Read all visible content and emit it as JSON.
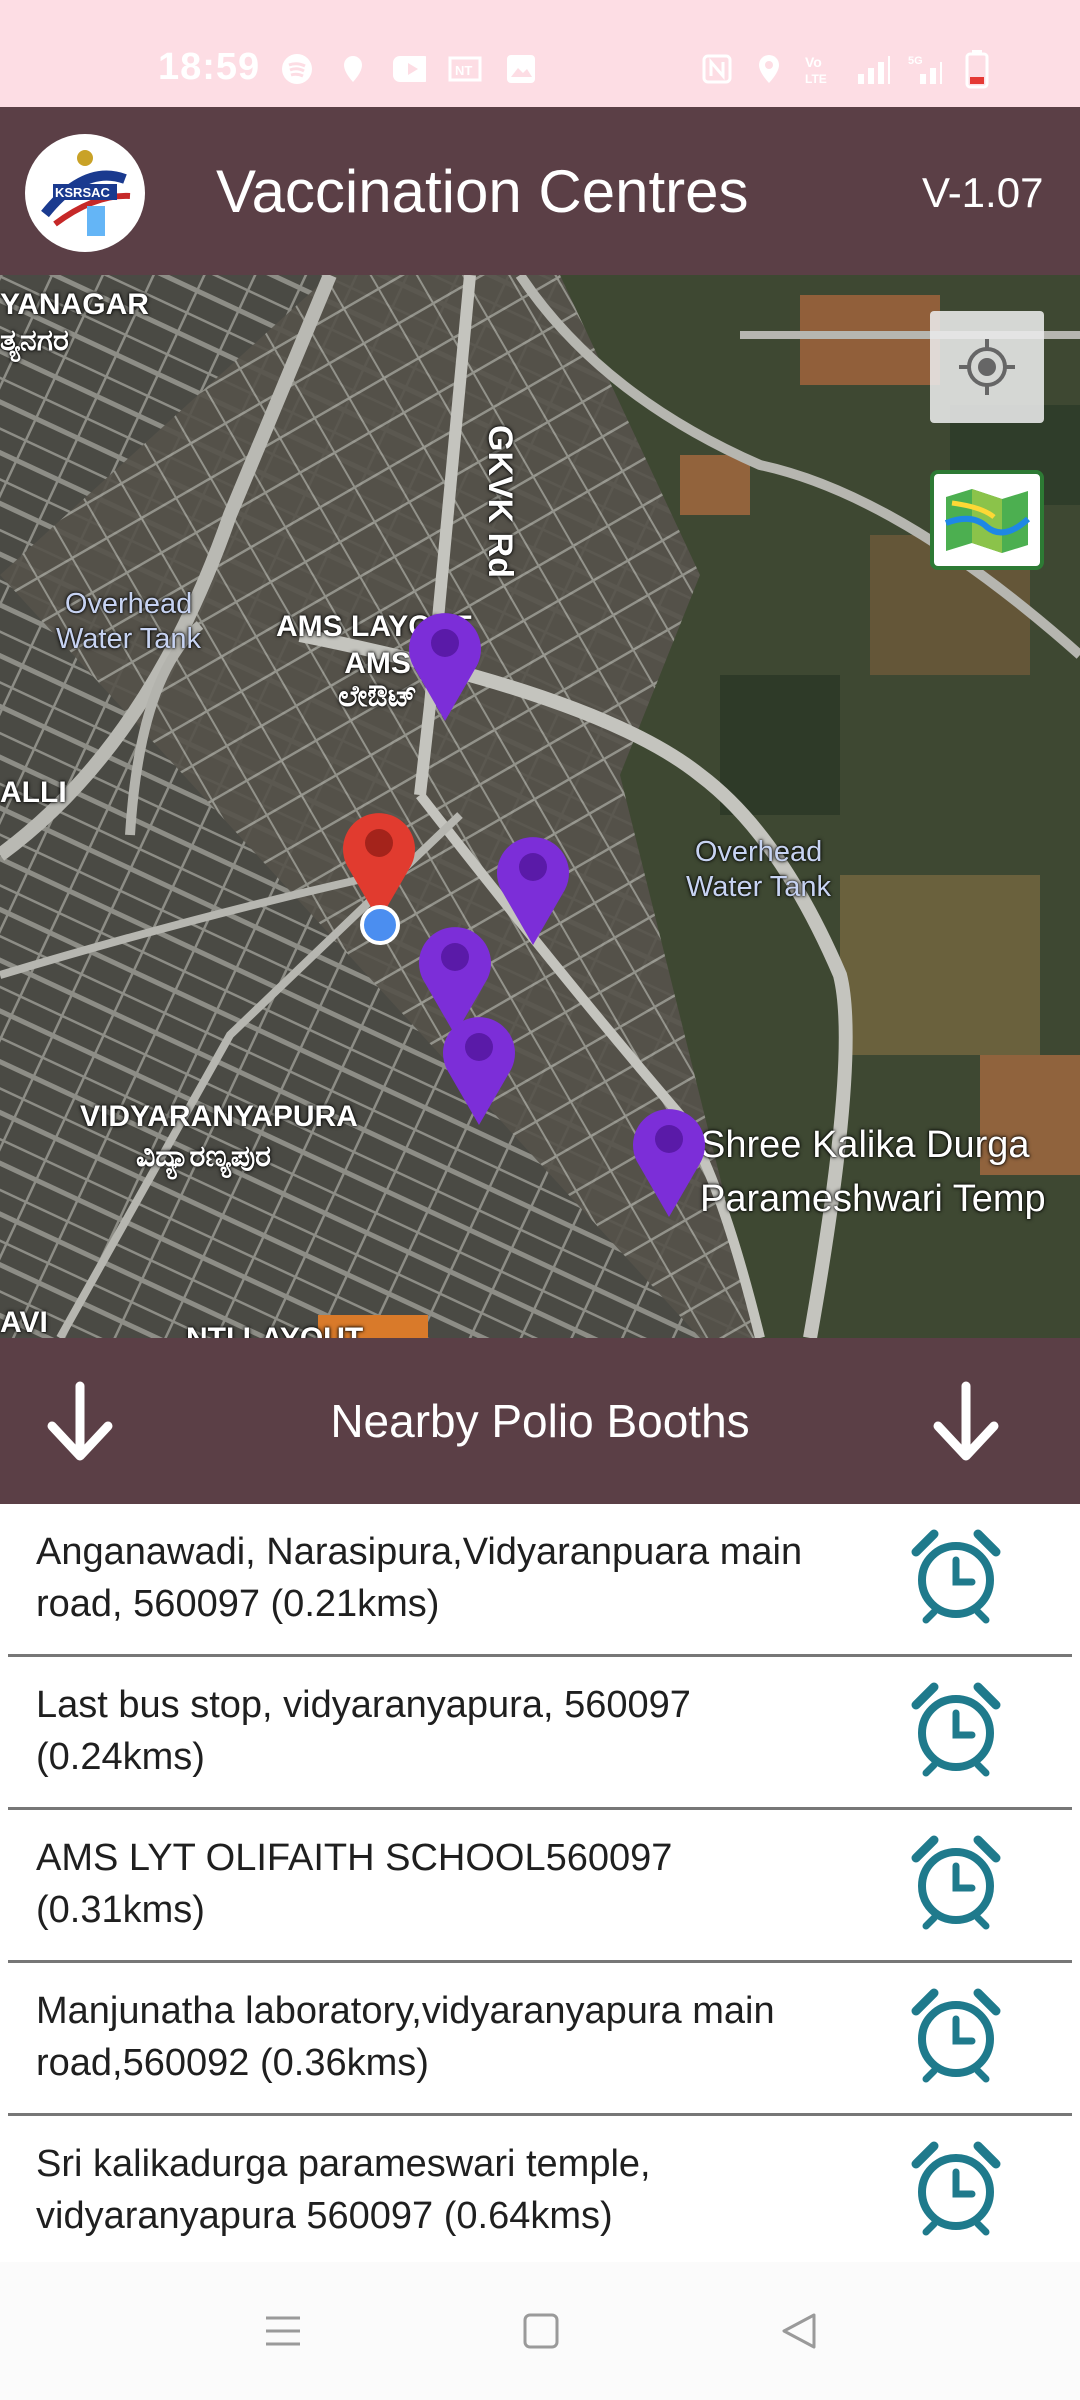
{
  "status_bar": {
    "time": "18:59",
    "icons": [
      "spotify-icon",
      "pin-icon",
      "youtube-icon",
      "nt-icon",
      "gallery-icon",
      "nfc-icon",
      "location-icon",
      "volte-icon",
      "signal-icon",
      "5g-signal-icon",
      "battery-low-icon"
    ]
  },
  "app_bar": {
    "title": "Vaccination Centres",
    "version": "V-1.07",
    "logo_text": "KSRSAC"
  },
  "map": {
    "labels": {
      "yanagar": "YANAGAR",
      "yanagar_kn": "ತ್ಯನಗರ",
      "gkvk_rd": "GKVK Rd",
      "overhead_tank_1": "Overhead\nWater Tank",
      "ams_layout": "AMS LAYOUT",
      "ams_layout_kn": "AMS\nಲೇಔಟ್",
      "alli": "ALLI",
      "overhead_tank_2": "Overhead\nWater Tank",
      "vidyaranyapura": "VIDYARANYAPURA",
      "vidyaranyapura_kn": "ವಿದ್ಯಾರಣ್ಯಪುರ",
      "temple_1": "Shree Kalika Durga",
      "temple_2": "Parameshwari Temp",
      "avi": "AVI",
      "ntl_layout": "NTI LAYOUT"
    },
    "accent_marker": "#7c2ed8",
    "current_marker": "#e13b2f"
  },
  "section": {
    "title": "Nearby Polio Booths"
  },
  "booths": [
    {
      "line1": "Anganawadi, Narasipura,Vidyaranpuara main",
      "line2": "road, 560097  (0.21kms)"
    },
    {
      "line1": "Last bus stop, vidyaranyapura, 560097",
      "line2": "(0.24kms)"
    },
    {
      "line1": "AMS LYT OLIFAITH SCHOOL560097",
      "line2": "(0.31kms)"
    },
    {
      "line1": "Manjunatha laboratory,vidyaranyapura main",
      "line2": "road,560092  (0.36kms)"
    },
    {
      "line1": "Sri kalikadurga parameswari temple,",
      "line2": "vidyaranyapura 560097  (0.64kms)"
    }
  ],
  "colors": {
    "appbar": "#5b3f46",
    "statusbar": "#fddde4",
    "alarm": "#1f7a8c"
  }
}
